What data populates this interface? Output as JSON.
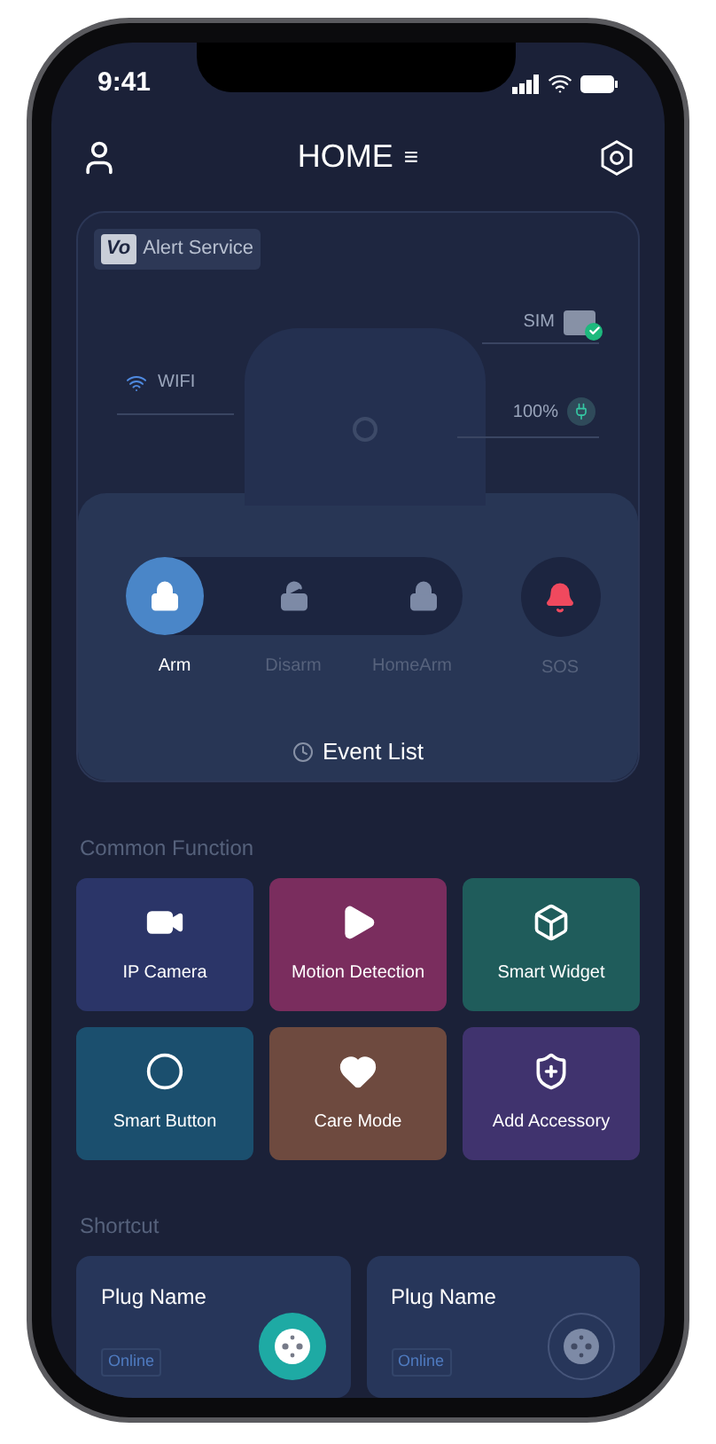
{
  "status_bar": {
    "time": "9:41"
  },
  "header": {
    "title": "HOME",
    "menu_glyph": "≡"
  },
  "device": {
    "badge_logo": "Vo",
    "badge_label": "Alert Service",
    "wifi": "WIFI",
    "sim": "SIM",
    "sim_ok": true,
    "battery": "100%"
  },
  "modes": [
    {
      "label": "Arm",
      "kind": "arm",
      "selected": true
    },
    {
      "label": "Disarm",
      "kind": "disarm",
      "selected": false
    },
    {
      "label": "HomeArm",
      "kind": "homearm",
      "selected": false
    }
  ],
  "sos": {
    "label": "SOS"
  },
  "event_list": "Event List",
  "common_function": {
    "title": "Common Function",
    "tiles": [
      {
        "label": "IP Camera",
        "kind": "camera",
        "color": "#2b3568"
      },
      {
        "label": "Motion Detection",
        "kind": "motion",
        "color": "#7a2d5e"
      },
      {
        "label": "Smart Widget",
        "kind": "widget",
        "color": "#1f5c5b"
      },
      {
        "label": "Smart Button",
        "kind": "button",
        "color": "#1b4f6e"
      },
      {
        "label": "Care Mode",
        "kind": "care",
        "color": "#6e4a3f"
      },
      {
        "label": "Add Accessory",
        "kind": "accessory",
        "color": "#40336e"
      }
    ]
  },
  "shortcut": {
    "title": "Shortcut",
    "plugs": [
      {
        "name": "Plug Name",
        "status": "Online",
        "on": true
      },
      {
        "name": "Plug Name",
        "status": "Online",
        "on": false
      }
    ]
  }
}
